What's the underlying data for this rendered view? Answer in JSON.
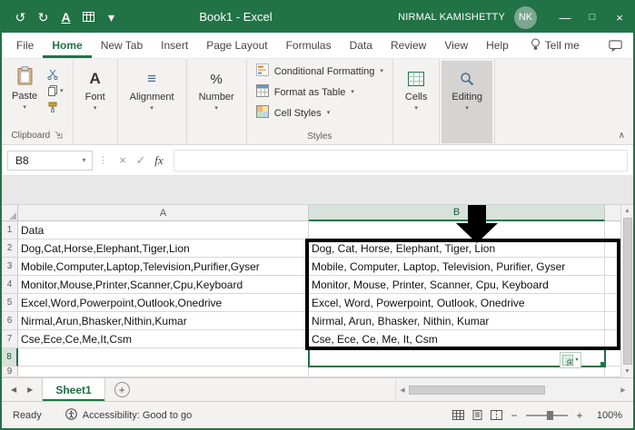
{
  "titlebar": {
    "title": "Book1  -  Excel",
    "user_name": "NIRMAL KAMISHETTY",
    "avatar_initials": "NK"
  },
  "ribbon_tabs": {
    "items": [
      "File",
      "Home",
      "New Tab",
      "Insert",
      "Page Layout",
      "Formulas",
      "Data",
      "Review",
      "View",
      "Help"
    ],
    "active": "Home",
    "tell_me": "Tell me"
  },
  "ribbon": {
    "paste_label": "Paste",
    "clipboard_label": "Clipboard",
    "font_label": "Font",
    "alignment_label": "Alignment",
    "number_label": "Number",
    "number_icon": "%",
    "styles": {
      "conditional_formatting": "Conditional Formatting",
      "format_as_table": "Format as Table",
      "cell_styles": "Cell Styles",
      "group_label": "Styles"
    },
    "cells_label": "Cells",
    "editing_label": "Editing"
  },
  "formula_bar": {
    "name_box": "B8",
    "fx": "fx",
    "formula_value": ""
  },
  "grid": {
    "columns": [
      "A",
      "B"
    ],
    "active_cell": "B8",
    "rows": [
      {
        "n": "1",
        "a": "Data",
        "b": ""
      },
      {
        "n": "2",
        "a": "Dog,Cat,Horse,Elephant,Tiger,Lion",
        "b": "Dog, Cat, Horse, Elephant, Tiger, Lion"
      },
      {
        "n": "3",
        "a": "Mobile,Computer,Laptop,Television,Purifier,Gyser",
        "b": "Mobile, Computer, Laptop, Television, Purifier, Gyser"
      },
      {
        "n": "4",
        "a": "Monitor,Mouse,Printer,Scanner,Cpu,Keyboard",
        "b": "Monitor, Mouse, Printer, Scanner, Cpu, Keyboard"
      },
      {
        "n": "5",
        "a": "Excel,Word,Powerpoint,Outlook,Onedrive",
        "b": "Excel, Word, Powerpoint, Outlook, Onedrive"
      },
      {
        "n": "6",
        "a": "Nirmal,Arun,Bhasker,Nithin,Kumar",
        "b": "Nirmal, Arun, Bhasker, Nithin, Kumar"
      },
      {
        "n": "7",
        "a": "Cse,Ece,Ce,Me,It,Csm",
        "b": "Cse, Ece, Ce, Me, It, Csm"
      },
      {
        "n": "8",
        "a": "",
        "b": ""
      },
      {
        "n": "9",
        "a": "",
        "b": ""
      }
    ]
  },
  "sheet_bar": {
    "sheet_name": "Sheet1"
  },
  "status_bar": {
    "mode": "Ready",
    "accessibility": "Accessibility: Good to go",
    "zoom": "100%"
  },
  "colors": {
    "excel_green": "#217346",
    "selected_header_bg": "#d7e2db",
    "annotation_color": "#000000"
  },
  "icons": {
    "undo": "↺",
    "redo": "↻",
    "underline": "A",
    "caret_down": "▾",
    "minimize": "—",
    "maximize": "□",
    "close": "×",
    "separator": "⋮",
    "cancel": "×",
    "enter": "✓",
    "collapse_ribbon": "∧",
    "alignment": "≡",
    "font_a": "A",
    "scroll_up": "▲",
    "scroll_down": "▼",
    "scroll_left": "◀",
    "scroll_right": "▶",
    "nav_left": "◀",
    "nav_right": "▶",
    "add_sheet": "+",
    "zoom_out": "−",
    "zoom_in": "+"
  }
}
